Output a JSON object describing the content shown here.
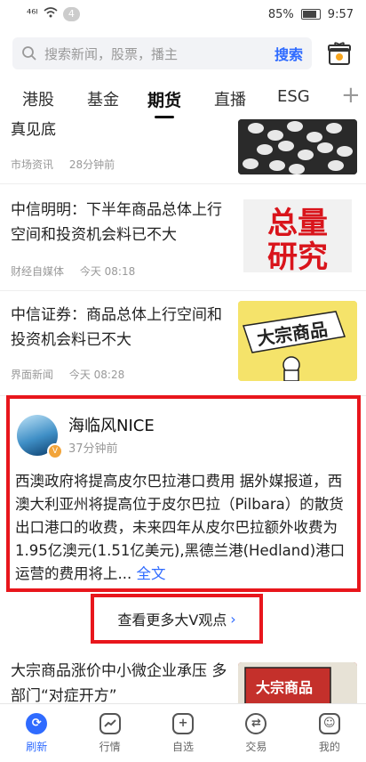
{
  "statusbar": {
    "signal": "⁴⁶ᴵ",
    "badge": "4",
    "battery": "85%",
    "time": "9:57"
  },
  "search": {
    "placeholder": "搜索新闻，股票，播主",
    "button": "搜索"
  },
  "tabs": [
    {
      "label": "港股"
    },
    {
      "label": "基金"
    },
    {
      "label": "期货",
      "active": true
    },
    {
      "label": "直播"
    },
    {
      "label": "ESG"
    }
  ],
  "feed": [
    {
      "title": "真见底",
      "source": "市场资讯",
      "time": "28分钟前"
    },
    {
      "title": "中信明明：下半年商品总体上行空间和投资机会料已不大",
      "source": "财经自媒体",
      "time": "今天 08:18",
      "thumb_text": "总量研究"
    },
    {
      "title": "中信证券：商品总体上行空间和投资机会料已不大",
      "source": "界面新闻",
      "time": "今天 08:28",
      "thumb_text": "大宗商品"
    },
    {
      "title": "大宗商品涨价中小微企业承压 多部门“对症开方”",
      "thumb_text": "大宗商品"
    }
  ],
  "vpost": {
    "name": "海临风NICE",
    "time": "37分钟前",
    "body": "西澳政府将提高皮尔巴拉港口费用 据外媒报道，西澳大利亚州将提高位于皮尔巴拉（Pilbara）的散货出口港口的收费，未来四年从皮尔巴拉额外收费为1.95亿澳元(1.51亿美元),黑德兰港(Hedland)港口运营的费用将上...",
    "full": "全文"
  },
  "more_button": {
    "label": "查看更多大V观点",
    "chev": "›"
  },
  "bottom_nav": [
    {
      "label": "刷新",
      "icon": "refresh-icon",
      "active": true
    },
    {
      "label": "行情",
      "icon": "chart-icon"
    },
    {
      "label": "自选",
      "icon": "plus-square-icon"
    },
    {
      "label": "交易",
      "icon": "exchange-icon"
    },
    {
      "label": "我的",
      "icon": "profile-icon"
    }
  ],
  "colors": {
    "accent": "#2f6bff",
    "highlight": "#e8161c"
  }
}
